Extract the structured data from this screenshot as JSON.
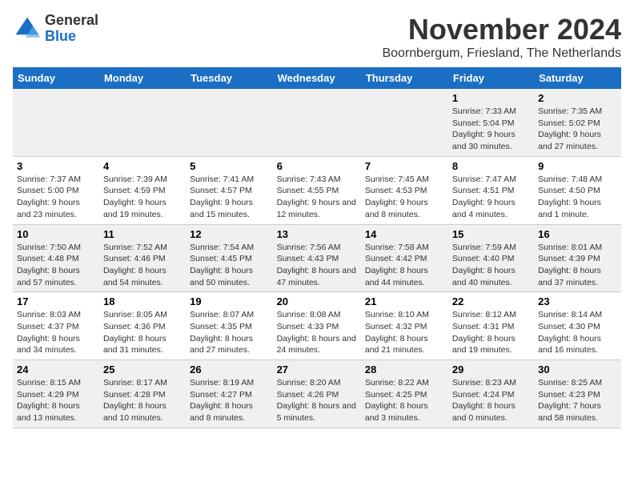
{
  "header": {
    "logo_general": "General",
    "logo_blue": "Blue",
    "month_title": "November 2024",
    "location": "Boornbergum, Friesland, The Netherlands"
  },
  "weekdays": [
    "Sunday",
    "Monday",
    "Tuesday",
    "Wednesday",
    "Thursday",
    "Friday",
    "Saturday"
  ],
  "weeks": [
    [
      {
        "day": "",
        "info": ""
      },
      {
        "day": "",
        "info": ""
      },
      {
        "day": "",
        "info": ""
      },
      {
        "day": "",
        "info": ""
      },
      {
        "day": "",
        "info": ""
      },
      {
        "day": "1",
        "info": "Sunrise: 7:33 AM\nSunset: 5:04 PM\nDaylight: 9 hours and 30 minutes."
      },
      {
        "day": "2",
        "info": "Sunrise: 7:35 AM\nSunset: 5:02 PM\nDaylight: 9 hours and 27 minutes."
      }
    ],
    [
      {
        "day": "3",
        "info": "Sunrise: 7:37 AM\nSunset: 5:00 PM\nDaylight: 9 hours and 23 minutes."
      },
      {
        "day": "4",
        "info": "Sunrise: 7:39 AM\nSunset: 4:59 PM\nDaylight: 9 hours and 19 minutes."
      },
      {
        "day": "5",
        "info": "Sunrise: 7:41 AM\nSunset: 4:57 PM\nDaylight: 9 hours and 15 minutes."
      },
      {
        "day": "6",
        "info": "Sunrise: 7:43 AM\nSunset: 4:55 PM\nDaylight: 9 hours and 12 minutes."
      },
      {
        "day": "7",
        "info": "Sunrise: 7:45 AM\nSunset: 4:53 PM\nDaylight: 9 hours and 8 minutes."
      },
      {
        "day": "8",
        "info": "Sunrise: 7:47 AM\nSunset: 4:51 PM\nDaylight: 9 hours and 4 minutes."
      },
      {
        "day": "9",
        "info": "Sunrise: 7:48 AM\nSunset: 4:50 PM\nDaylight: 9 hours and 1 minute."
      }
    ],
    [
      {
        "day": "10",
        "info": "Sunrise: 7:50 AM\nSunset: 4:48 PM\nDaylight: 8 hours and 57 minutes."
      },
      {
        "day": "11",
        "info": "Sunrise: 7:52 AM\nSunset: 4:46 PM\nDaylight: 8 hours and 54 minutes."
      },
      {
        "day": "12",
        "info": "Sunrise: 7:54 AM\nSunset: 4:45 PM\nDaylight: 8 hours and 50 minutes."
      },
      {
        "day": "13",
        "info": "Sunrise: 7:56 AM\nSunset: 4:43 PM\nDaylight: 8 hours and 47 minutes."
      },
      {
        "day": "14",
        "info": "Sunrise: 7:58 AM\nSunset: 4:42 PM\nDaylight: 8 hours and 44 minutes."
      },
      {
        "day": "15",
        "info": "Sunrise: 7:59 AM\nSunset: 4:40 PM\nDaylight: 8 hours and 40 minutes."
      },
      {
        "day": "16",
        "info": "Sunrise: 8:01 AM\nSunset: 4:39 PM\nDaylight: 8 hours and 37 minutes."
      }
    ],
    [
      {
        "day": "17",
        "info": "Sunrise: 8:03 AM\nSunset: 4:37 PM\nDaylight: 8 hours and 34 minutes."
      },
      {
        "day": "18",
        "info": "Sunrise: 8:05 AM\nSunset: 4:36 PM\nDaylight: 8 hours and 31 minutes."
      },
      {
        "day": "19",
        "info": "Sunrise: 8:07 AM\nSunset: 4:35 PM\nDaylight: 8 hours and 27 minutes."
      },
      {
        "day": "20",
        "info": "Sunrise: 8:08 AM\nSunset: 4:33 PM\nDaylight: 8 hours and 24 minutes."
      },
      {
        "day": "21",
        "info": "Sunrise: 8:10 AM\nSunset: 4:32 PM\nDaylight: 8 hours and 21 minutes."
      },
      {
        "day": "22",
        "info": "Sunrise: 8:12 AM\nSunset: 4:31 PM\nDaylight: 8 hours and 19 minutes."
      },
      {
        "day": "23",
        "info": "Sunrise: 8:14 AM\nSunset: 4:30 PM\nDaylight: 8 hours and 16 minutes."
      }
    ],
    [
      {
        "day": "24",
        "info": "Sunrise: 8:15 AM\nSunset: 4:29 PM\nDaylight: 8 hours and 13 minutes."
      },
      {
        "day": "25",
        "info": "Sunrise: 8:17 AM\nSunset: 4:28 PM\nDaylight: 8 hours and 10 minutes."
      },
      {
        "day": "26",
        "info": "Sunrise: 8:19 AM\nSunset: 4:27 PM\nDaylight: 8 hours and 8 minutes."
      },
      {
        "day": "27",
        "info": "Sunrise: 8:20 AM\nSunset: 4:26 PM\nDaylight: 8 hours and 5 minutes."
      },
      {
        "day": "28",
        "info": "Sunrise: 8:22 AM\nSunset: 4:25 PM\nDaylight: 8 hours and 3 minutes."
      },
      {
        "day": "29",
        "info": "Sunrise: 8:23 AM\nSunset: 4:24 PM\nDaylight: 8 hours and 0 minutes."
      },
      {
        "day": "30",
        "info": "Sunrise: 8:25 AM\nSunset: 4:23 PM\nDaylight: 7 hours and 58 minutes."
      }
    ]
  ]
}
